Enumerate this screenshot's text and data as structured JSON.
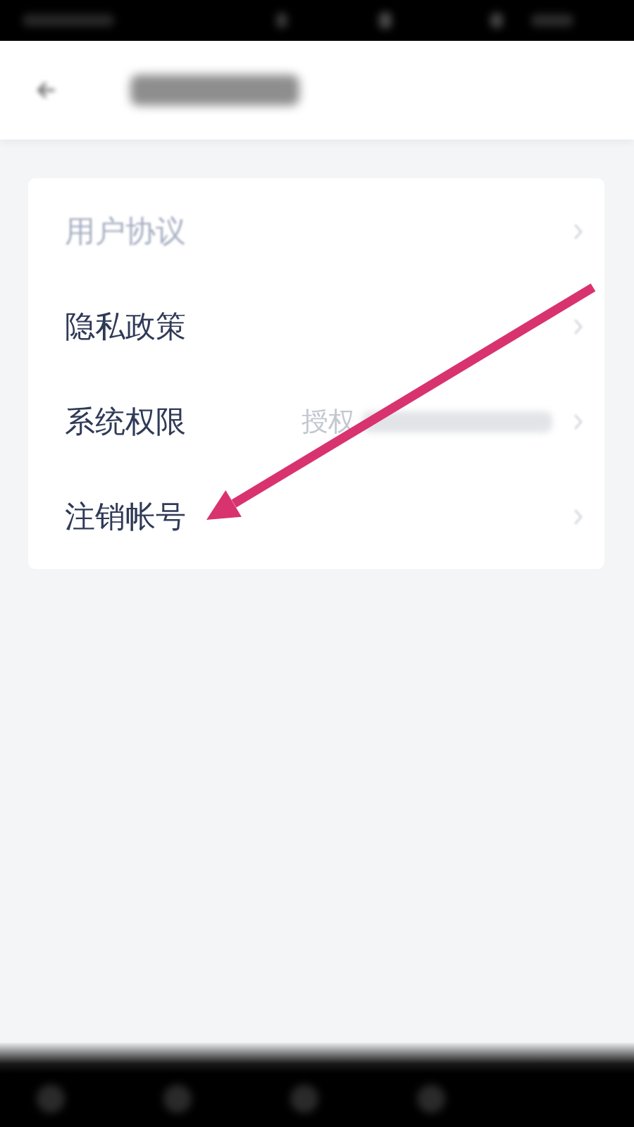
{
  "settings": [
    {
      "label": "用户协议",
      "obscured": true,
      "arrow": false
    },
    {
      "label": "隐私政策",
      "obscured": false,
      "arrow": false
    },
    {
      "label": "系统权限",
      "obscured": false,
      "arrow": false,
      "value": "授权",
      "value_obscured": true
    },
    {
      "label": "注销帐号",
      "obscured": false,
      "arrow": true
    }
  ]
}
